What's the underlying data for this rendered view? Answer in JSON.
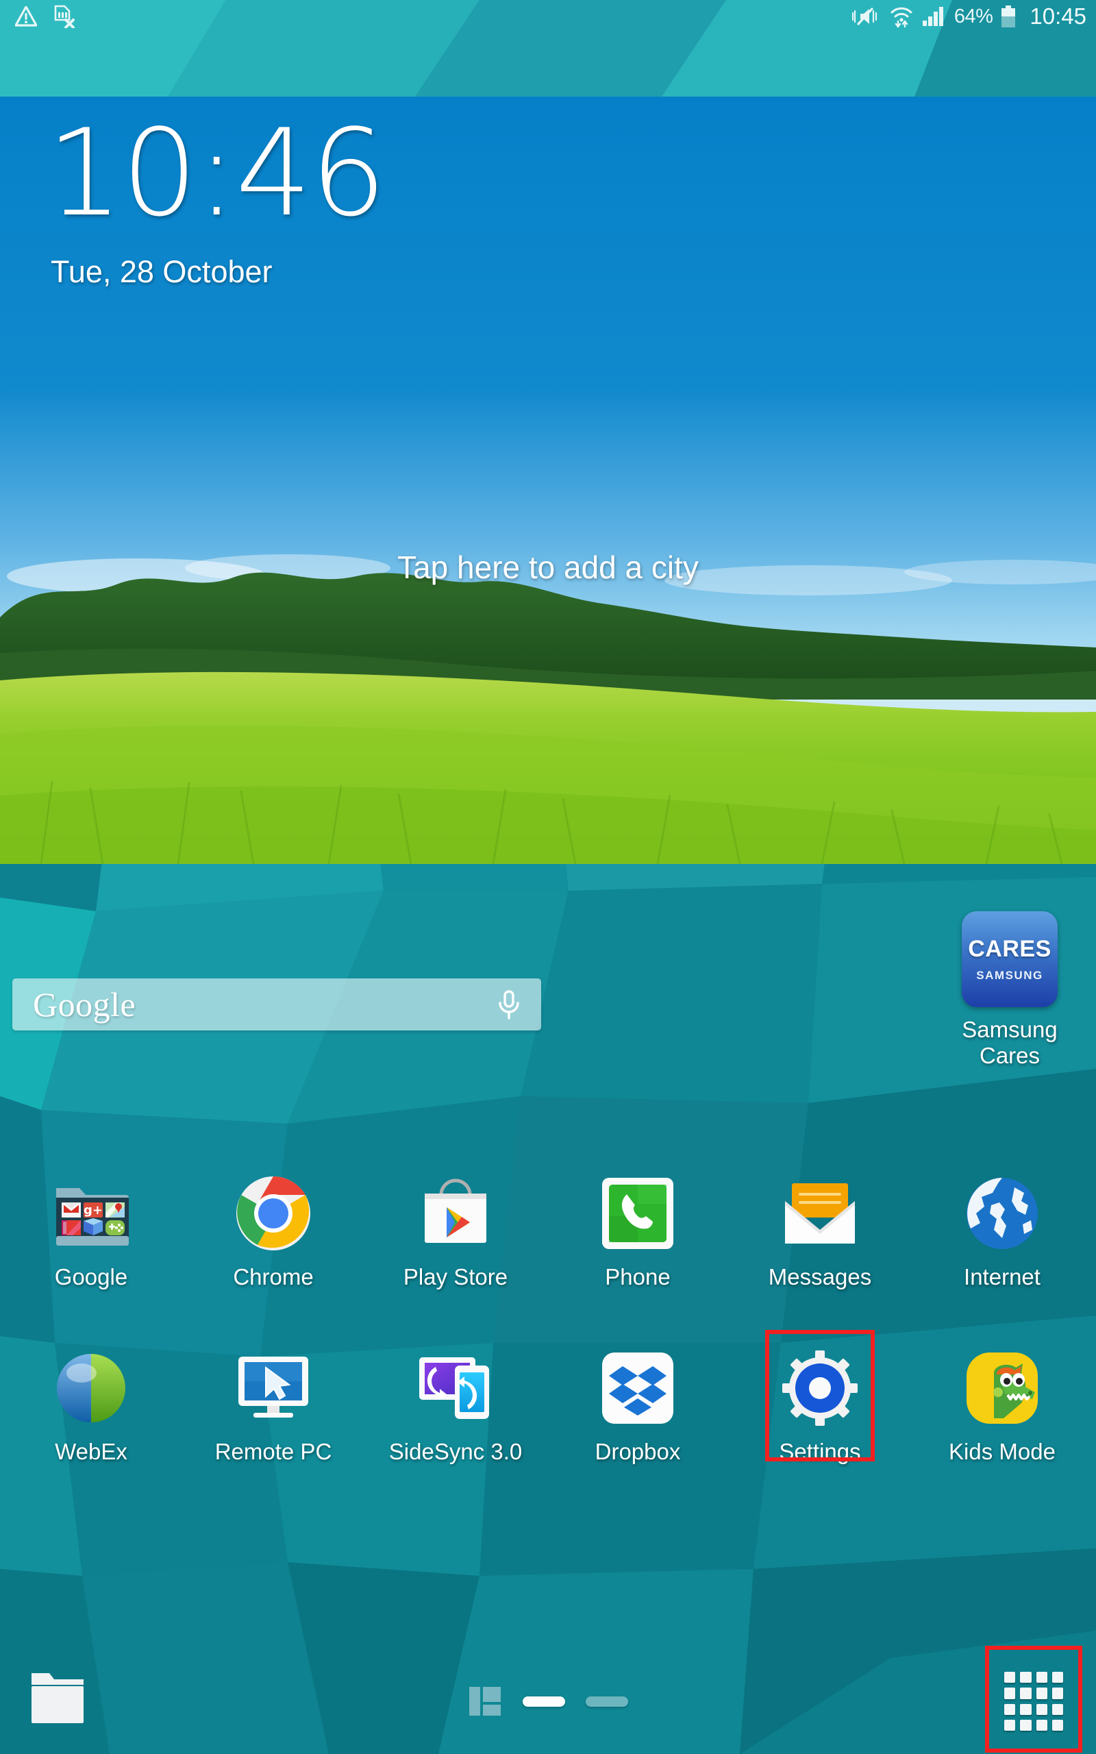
{
  "status_bar": {
    "left_icons": [
      "warning-triangle-icon",
      "no-sim-card-icon"
    ],
    "right_icons": [
      "mute-vibrate-icon",
      "wifi-transfer-icon",
      "signal-bars-icon",
      "battery-icon"
    ],
    "battery_percent": "64%",
    "clock": "10:45"
  },
  "widget": {
    "clock_time": "10:46",
    "date": "Tue, 28 October",
    "weather_hint": "Tap here to add a city"
  },
  "search": {
    "logo_text": "Google",
    "mic_icon": "microphone-icon"
  },
  "cares_widget": {
    "icon_main": "CARES",
    "icon_sub": "SAMSUNG",
    "label": "Samsung Cares"
  },
  "apps": {
    "row1": [
      {
        "label": "Google",
        "icon": "google-folder-icon"
      },
      {
        "label": "Chrome",
        "icon": "chrome-icon"
      },
      {
        "label": "Play Store",
        "icon": "play-store-icon"
      },
      {
        "label": "Phone",
        "icon": "phone-icon"
      },
      {
        "label": "Messages",
        "icon": "messages-icon"
      },
      {
        "label": "Internet",
        "icon": "internet-globe-icon"
      }
    ],
    "row2": [
      {
        "label": "WebEx",
        "icon": "webex-icon"
      },
      {
        "label": "Remote PC",
        "icon": "remote-pc-icon"
      },
      {
        "label": "SideSync 3.0",
        "icon": "sidesync-icon"
      },
      {
        "label": "Dropbox",
        "icon": "dropbox-icon"
      },
      {
        "label": "Settings",
        "icon": "settings-gear-icon",
        "highlighted": true
      },
      {
        "label": "Kids Mode",
        "icon": "kids-mode-icon"
      }
    ]
  },
  "bottom_bar": {
    "folder_icon": "folder-icon",
    "layout_icon": "home-layout-icon",
    "page_dots": [
      "active",
      "inactive"
    ],
    "drawer_icon": "apps-grid-icon",
    "drawer_highlighted": true
  },
  "colors": {
    "highlight": "#f42020",
    "wallpaper_base": "#0d7f8f",
    "status_text": "#eaf7f8"
  }
}
